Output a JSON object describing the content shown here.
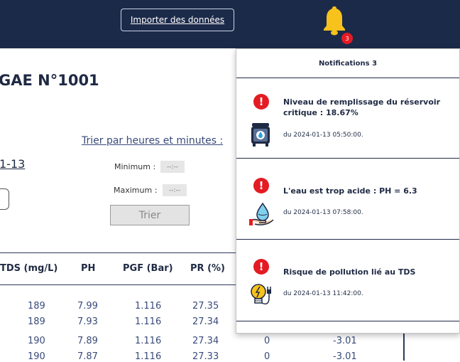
{
  "header": {
    "import_label": "Importer des données",
    "notification_count": "3"
  },
  "page": {
    "title_partial": "GAE N°1001",
    "date_link_partial": "1-13",
    "sort": {
      "label": "Trier par heures et minutes :",
      "min_label": "Minimum :",
      "max_label": "Maximum :",
      "min_value": "--:--",
      "max_value": "--:--",
      "button_label": "Trier"
    }
  },
  "table": {
    "headers": [
      "TDS (mg/L)",
      "PH",
      "PGF (Bar)",
      "PR (%)"
    ],
    "rows": [
      [
        "189",
        "7.99",
        "1.116",
        "27.35",
        "",
        ""
      ],
      [
        "189",
        "7.93",
        "1.116",
        "27.34",
        "",
        ""
      ],
      [
        "190",
        "7.89",
        "1.116",
        "27.34",
        "0",
        "-3.01"
      ],
      [
        "190",
        "7.87",
        "1.116",
        "27.33",
        "0",
        "-3.01"
      ]
    ]
  },
  "notifications": {
    "title": "Notifications 3",
    "items": [
      {
        "icon": "water-tank-icon",
        "alert_icon": "exclamation-icon",
        "message": "Niveau de remplissage du réservoir critique : 18.67%",
        "date": "du 2024-01-13 05:50:00."
      },
      {
        "icon": "water-drop-hand-icon",
        "alert_icon": "exclamation-icon",
        "message": "L'eau est trop acide : PH = 6.3",
        "date": "du 2024-01-13 07:58:00."
      },
      {
        "icon": "bulb-plug-icon",
        "alert_icon": "exclamation-icon",
        "message": "Risque de pollution lié au TDS",
        "date": "du 2024-01-13 11:42:00."
      }
    ]
  },
  "colors": {
    "navbar": "#1c2a4a",
    "bell": "#f7c21b",
    "alert": "#e41b23"
  }
}
